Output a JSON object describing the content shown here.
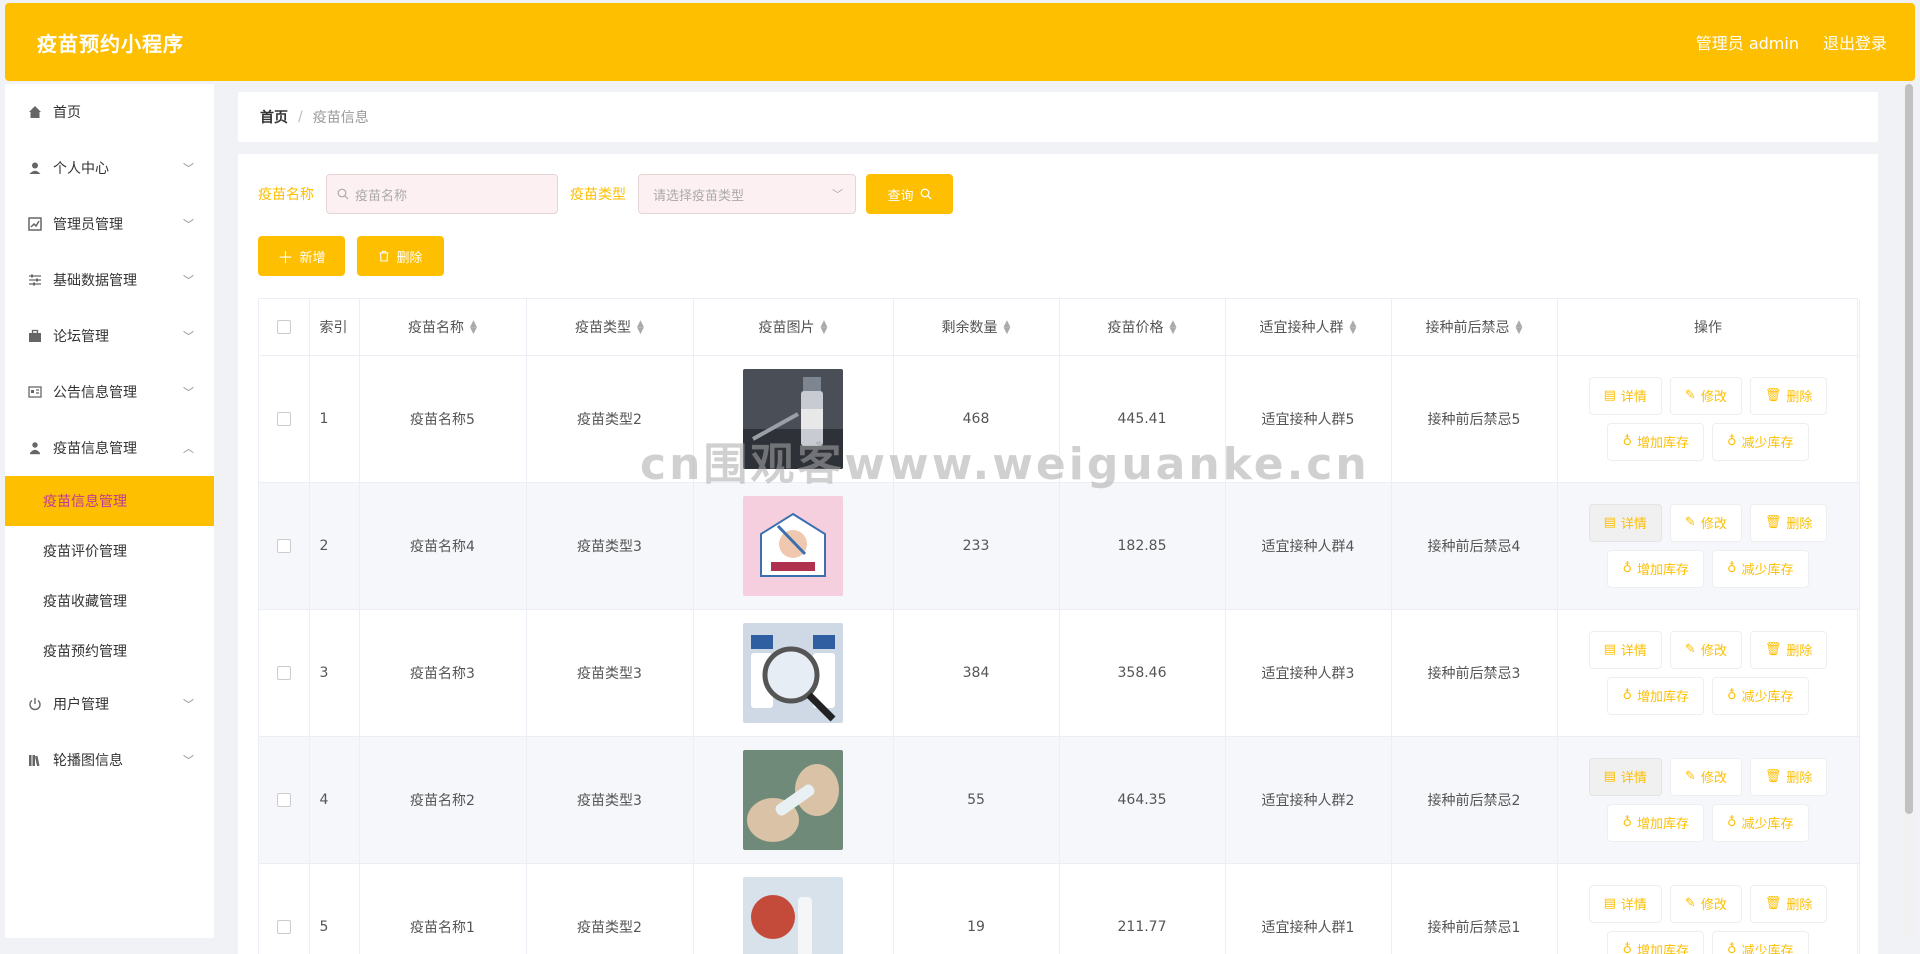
{
  "header": {
    "title": "疫苗预约小程序",
    "user_label": "管理员 admin",
    "logout_label": "退出登录"
  },
  "sidebar": {
    "items": [
      {
        "label": "首页",
        "icon": "home-icon"
      },
      {
        "label": "个人中心",
        "icon": "user-icon"
      },
      {
        "label": "管理员管理",
        "icon": "chart-icon"
      },
      {
        "label": "基础数据管理",
        "icon": "sliders-icon"
      },
      {
        "label": "论坛管理",
        "icon": "briefcase-icon"
      },
      {
        "label": "公告信息管理",
        "icon": "card-icon"
      },
      {
        "label": "疫苗信息管理",
        "icon": "person-icon"
      }
    ],
    "subitems": [
      {
        "label": "疫苗信息管理",
        "active": true
      },
      {
        "label": "疫苗评价管理"
      },
      {
        "label": "疫苗收藏管理"
      },
      {
        "label": "疫苗预约管理"
      }
    ],
    "items_after": [
      {
        "label": "用户管理",
        "icon": "power-icon"
      },
      {
        "label": "轮播图信息",
        "icon": "library-icon"
      }
    ]
  },
  "breadcrumb": {
    "home": "首页",
    "separator": "/",
    "current": "疫苗信息"
  },
  "search": {
    "name_label": "疫苗名称",
    "name_placeholder": "疫苗名称",
    "type_label": "疫苗类型",
    "type_placeholder": "请选择疫苗类型",
    "query_label": "查询"
  },
  "actions": {
    "add_label": "新增",
    "delete_label": "删除"
  },
  "table": {
    "headers": [
      "索引",
      "疫苗名称",
      "疫苗类型",
      "疫苗图片",
      "剩余数量",
      "疫苗价格",
      "适宜接种人群",
      "接种前后禁忌",
      "操作"
    ],
    "rows": [
      {
        "index": "1",
        "name": "疫苗名称5",
        "type": "疫苗类型2",
        "stock": "468",
        "price": "445.41",
        "crowd": "适宜接种人群5",
        "taboo": "接种前后禁忌5"
      },
      {
        "index": "2",
        "name": "疫苗名称4",
        "type": "疫苗类型3",
        "stock": "233",
        "price": "182.85",
        "crowd": "适宜接种人群4",
        "taboo": "接种前后禁忌4"
      },
      {
        "index": "3",
        "name": "疫苗名称3",
        "type": "疫苗类型3",
        "stock": "384",
        "price": "358.46",
        "crowd": "适宜接种人群3",
        "taboo": "接种前后禁忌3"
      },
      {
        "index": "4",
        "name": "疫苗名称2",
        "type": "疫苗类型3",
        "stock": "55",
        "price": "464.35",
        "crowd": "适宜接种人群2",
        "taboo": "接种前后禁忌2"
      },
      {
        "index": "5",
        "name": "疫苗名称1",
        "type": "疫苗类型2",
        "stock": "19",
        "price": "211.77",
        "crowd": "适宜接种人群1",
        "taboo": "接种前后禁忌1"
      }
    ],
    "ops": {
      "detail": "详情",
      "edit": "修改",
      "delete": "删除",
      "add_stock": "增加库存",
      "reduce_stock": "减少库存"
    }
  },
  "watermark": "cn围观客www.weiguanke.cn",
  "colors": {
    "accent": "#fdbf00",
    "active_text": "#c0399b"
  }
}
